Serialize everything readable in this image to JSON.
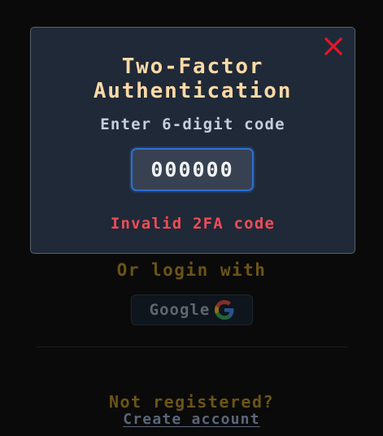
{
  "modal": {
    "title": "Two-Factor Authentication",
    "subtitle": "Enter 6-digit code",
    "code_value": "000000",
    "error": "Invalid 2FA code",
    "close_icon": "close-icon",
    "close_color": "#e0182a"
  },
  "background": {
    "or_login_with": "Or login with",
    "google_button_label": "Google",
    "google_icon": "google-g-icon",
    "not_registered": "Not registered?",
    "create_account": "Create account"
  },
  "colors": {
    "modal_bg": "#1f2937",
    "title": "#fcd9a6",
    "error": "#ef4d57",
    "input_border": "#2f6fce",
    "accent_dimmed": "#6b5417"
  }
}
